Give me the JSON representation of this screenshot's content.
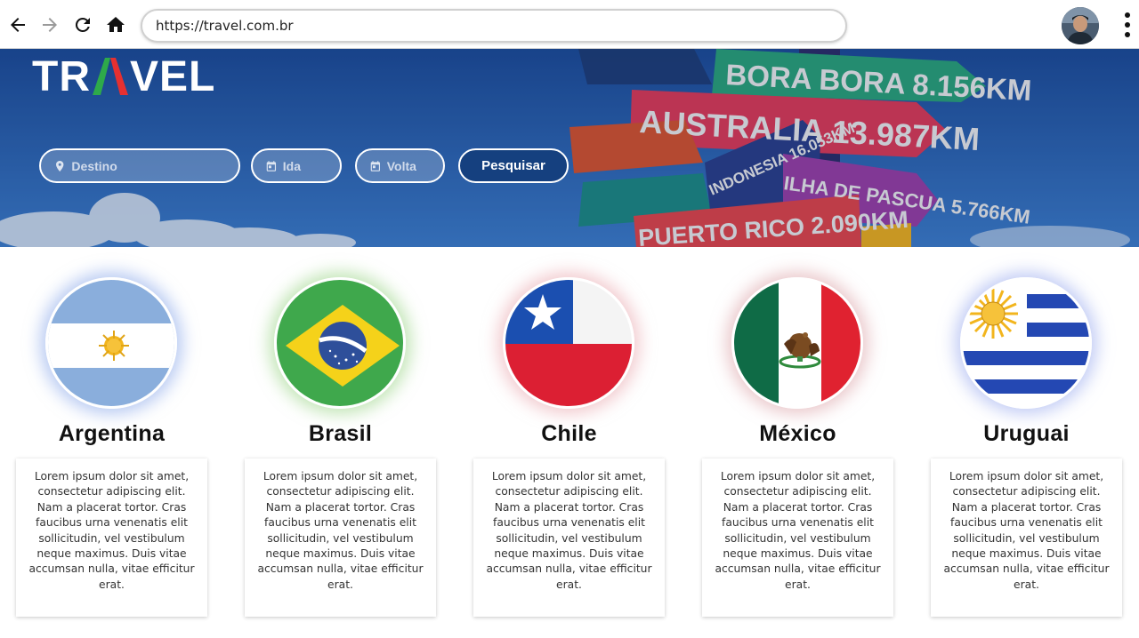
{
  "browser": {
    "url": "https://travel.com.br",
    "back_icon": "arrow-left-icon",
    "forward_icon": "arrow-right-icon",
    "reload_icon": "reload-icon",
    "home_icon": "home-icon",
    "menu_icon": "more-vertical-icon"
  },
  "hero": {
    "logo": {
      "part1": "TR",
      "part3": "VEL",
      "accent_colors": [
        "#2eaa4a",
        "#e63030"
      ]
    },
    "signs": [
      "BORA BORA 8.156KM",
      "AUSTRALIA 13.987KM",
      "INDONESIA 16.053KM",
      "ILHA DE PASCUA 5.766KM",
      "PUERTO RICO 2.090KM"
    ],
    "search": {
      "destination_placeholder": "Destino",
      "departure_placeholder": "Ida",
      "return_placeholder": "Volta",
      "button_label": "Pesquisar"
    }
  },
  "countries": [
    {
      "name": "Argentina",
      "description": "Lorem ipsum dolor sit amet, consectetur adipiscing elit. Nam a placerat tortor. Cras faucibus urna venenatis elit sollicitudin, vel vestibulum neque maximus. Duis vitae accumsan nulla, vitae efficitur erat.",
      "glow": "#7e9ee8"
    },
    {
      "name": "Brasil",
      "description": "Lorem ipsum dolor sit amet, consectetur adipiscing elit. Nam a placerat tortor. Cras faucibus urna venenatis elit sollicitudin, vel vestibulum neque maximus. Duis vitae accumsan nulla, vitae efficitur erat.",
      "glow": "#8fd07a"
    },
    {
      "name": "Chile",
      "description": "Lorem ipsum dolor sit amet, consectetur adipiscing elit. Nam a placerat tortor. Cras faucibus urna venenatis elit sollicitudin, vel vestibulum neque maximus. Duis vitae accumsan nulla, vitae efficitur erat.",
      "glow": "#e8a0a8"
    },
    {
      "name": "México",
      "description": "Lorem ipsum dolor sit amet, consectetur adipiscing elit. Nam a placerat tortor. Cras faucibus urna venenatis elit sollicitudin, vel vestibulum neque maximus. Duis vitae accumsan nulla, vitae efficitur erat.",
      "glow": "#d89aa0"
    },
    {
      "name": "Uruguai",
      "description": "Lorem ipsum dolor sit amet, consectetur adipiscing elit. Nam a placerat tortor. Cras faucibus urna venenatis elit sollicitudin, vel vestibulum neque maximus. Duis vitae accumsan nulla, vitae efficitur erat.",
      "glow": "#8fa2ec"
    }
  ]
}
